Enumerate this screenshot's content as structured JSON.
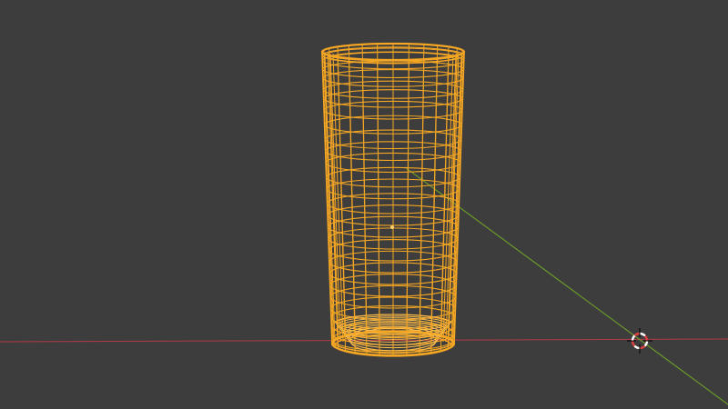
{
  "viewport": {
    "background": "#3d3d3d",
    "view": "wireframe"
  },
  "axes": {
    "x_axis_color": "#b23a48",
    "y_axis_color": "#6a9a2a"
  },
  "object": {
    "shape": "cylinder",
    "selected": true,
    "wire_color": "#f5a623",
    "highlight_color": "#ffc04d",
    "origin_color": "#ffcf70"
  },
  "cursor_3d": {
    "icon": "3d-cursor-icon",
    "ring_colors": [
      "#e04040",
      "#ffffff"
    ],
    "crosshair_color": "#000000"
  }
}
